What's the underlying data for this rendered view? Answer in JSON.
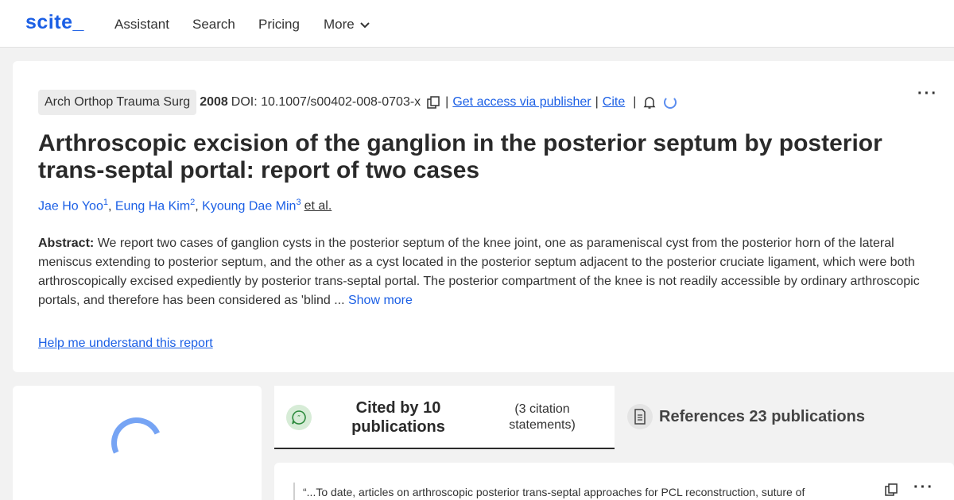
{
  "nav": {
    "logo": "scite_",
    "links": [
      "Assistant",
      "Search",
      "Pricing"
    ],
    "more": "More"
  },
  "article": {
    "journal": "Arch Orthop Trauma Surg",
    "year": "2008",
    "doi": "DOI: 10.1007/s00402-008-0703-x",
    "access_link": "Get access via publisher",
    "cite_link": "Cite",
    "title": "Arthroscopic excision of the ganglion in the posterior septum by posterior trans-septal portal: report of two cases",
    "authors": [
      {
        "name": "Jae Ho Yoo",
        "sup": "1"
      },
      {
        "name": "Eung Ha Kim",
        "sup": "2"
      },
      {
        "name": "Kyoung Dae Min",
        "sup": "3"
      }
    ],
    "et_al": "et al.",
    "abstract_label": "Abstract:",
    "abstract_text": "We report two cases of ganglion cysts in the posterior septum of the knee joint, one as parameniscal cyst from the posterior horn of the lateral meniscus extending to posterior septum, and the other as a cyst located in the posterior septum adjacent to the posterior cruciate ligament, which were both arthroscopically excised expediently by posterior trans-septal portal. The posterior compartment of the knee is not readily accessible by ordinary arthroscopic portals, and therefore has been considered as 'blind ...",
    "show_more": "Show more",
    "help_link": "Help me understand this report"
  },
  "tabs": {
    "cited_title": "Cited by 10 publications",
    "cited_sub": "(3 citation statements)",
    "references_title": "References 23 publications"
  },
  "citation": {
    "quote": "“...To date, articles on arthroscopic posterior trans-septal approaches for PCL reconstruction, suture of"
  },
  "colors": {
    "accent": "#1b5fe5",
    "background": "#f2f2f2",
    "cited_icon_bg": "#d7ecd7"
  },
  "icons": [
    "chevron-down-icon",
    "copy-icon",
    "bell-icon",
    "loading-spinner",
    "more-dots-icon",
    "citation-speech-icon",
    "document-icon"
  ]
}
